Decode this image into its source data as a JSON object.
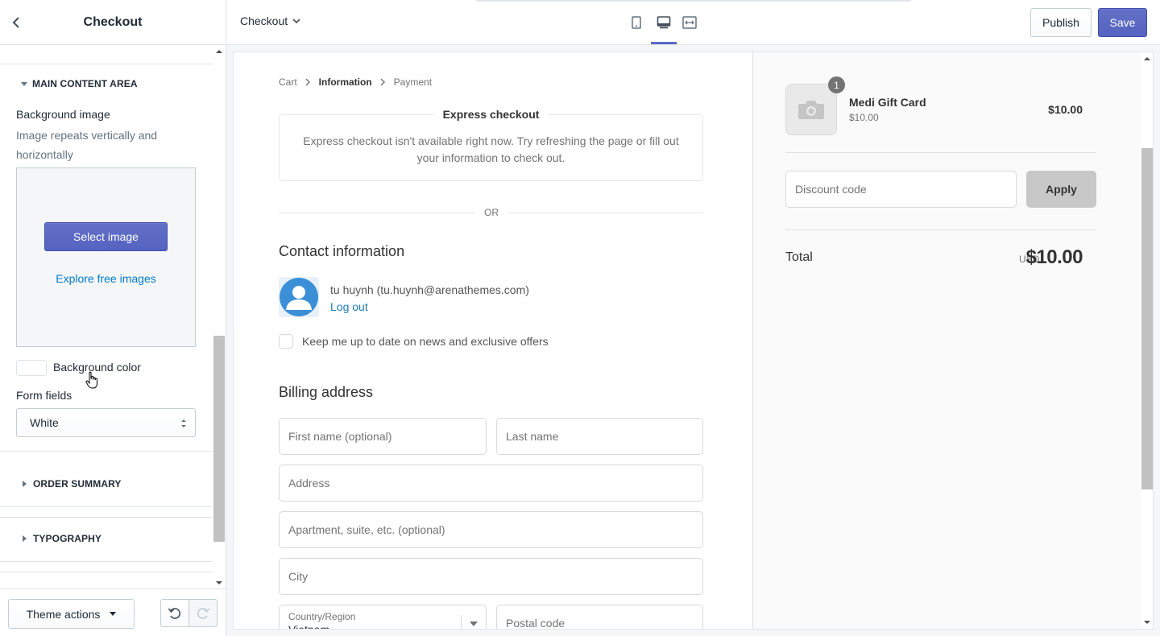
{
  "sidebar": {
    "title": "Checkout",
    "sections": {
      "main_content": "MAIN CONTENT AREA",
      "order_summary": "ORDER SUMMARY",
      "typography": "TYPOGRAPHY"
    },
    "background_image_label": "Background image",
    "background_image_help": "Image repeats vertically and horizontally",
    "select_image": "Select image",
    "explore_images": "Explore free images",
    "background_color_label": "Background color",
    "form_fields_label": "Form fields",
    "form_fields_value": "White",
    "theme_actions": "Theme actions"
  },
  "topbar": {
    "page_selector": "Checkout",
    "publish": "Publish",
    "save": "Save",
    "active_device": "desktop"
  },
  "checkout": {
    "breadcrumbs": [
      "Cart",
      "Information",
      "Payment"
    ],
    "express_title": "Express checkout",
    "express_message": "Express checkout isn't available right now. Try refreshing the page or fill out your information to check out.",
    "or": "OR",
    "contact_heading": "Contact information",
    "contact_name": "tu huynh (tu.huynh@arenathemes.com)",
    "logout": "Log out",
    "newsletter": "Keep me up to date on news and exclusive offers",
    "billing_heading": "Billing address",
    "fields": {
      "first_name": "First name (optional)",
      "last_name": "Last name",
      "address": "Address",
      "apartment": "Apartment, suite, etc. (optional)",
      "city": "City",
      "country_label": "Country/Region",
      "country_value": "Vietnam",
      "postal_code": "Postal code"
    }
  },
  "order_summary": {
    "quantity": "1",
    "item_name": "Medi Gift Card",
    "item_sub_price": "$10.00",
    "item_price": "$10.00",
    "discount_placeholder": "Discount code",
    "apply": "Apply",
    "total_label": "Total",
    "currency": "USD",
    "total": "$10.00"
  },
  "colors": {
    "primary": "#5c6ac4",
    "link": "#197bbd",
    "sidebar_link": "#007ace"
  }
}
